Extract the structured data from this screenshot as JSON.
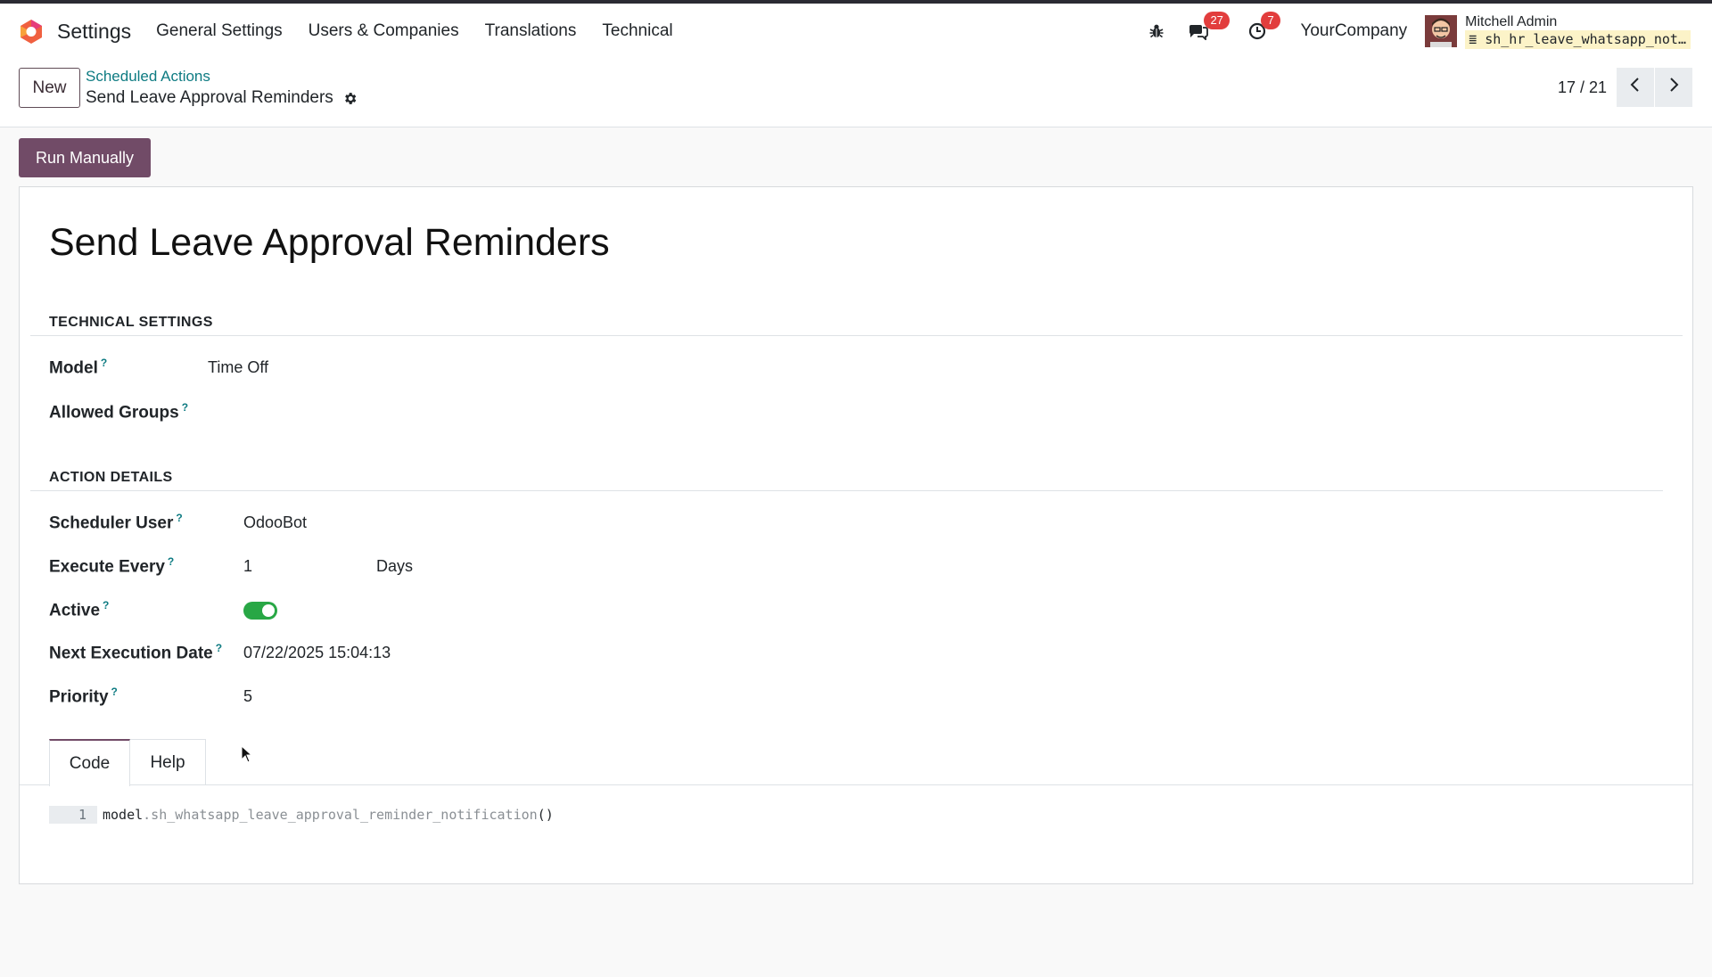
{
  "navbar": {
    "app_name": "Settings",
    "menu": [
      "General Settings",
      "Users & Companies",
      "Translations",
      "Technical"
    ],
    "messages_count": "27",
    "activities_count": "7",
    "company": "YourCompany",
    "user_name": "Mitchell Admin",
    "database": "sh_hr_leave_whatsapp_not…",
    "icons": [
      "bug-icon",
      "chat-icon",
      "clock-icon"
    ]
  },
  "control_panel": {
    "new_label": "New",
    "breadcrumb_parent": "Scheduled Actions",
    "record_title": "Send Leave Approval Reminders",
    "pager": "17 / 21"
  },
  "actions": {
    "run_manually": "Run Manually"
  },
  "form": {
    "title": "Send Leave Approval Reminders",
    "technical_settings": {
      "heading": "TECHNICAL SETTINGS",
      "model_label": "Model",
      "model_value": "Time Off",
      "groups_label": "Allowed Groups"
    },
    "action_details": {
      "heading": "ACTION DETAILS",
      "user_label": "Scheduler User",
      "user_value": "OdooBot",
      "interval_label": "Execute Every",
      "interval_number": "1",
      "interval_type": "Days",
      "active_label": "Active",
      "active": true,
      "next_label": "Next Execution Date",
      "next_value": "07/22/2025 15:04:13",
      "priority_label": "Priority",
      "priority_value": "5"
    },
    "help_mark": "?",
    "tabs": [
      "Code",
      "Help"
    ],
    "code": {
      "line_number": "1",
      "object": "model",
      "method": ".sh_whatsapp_leave_approval_reminder_notification",
      "parens": "()"
    }
  },
  "colors": {
    "primary": "#714b67",
    "link": "#0e7b82",
    "toggle_on": "#28a745",
    "badge": "#e23d3d"
  }
}
